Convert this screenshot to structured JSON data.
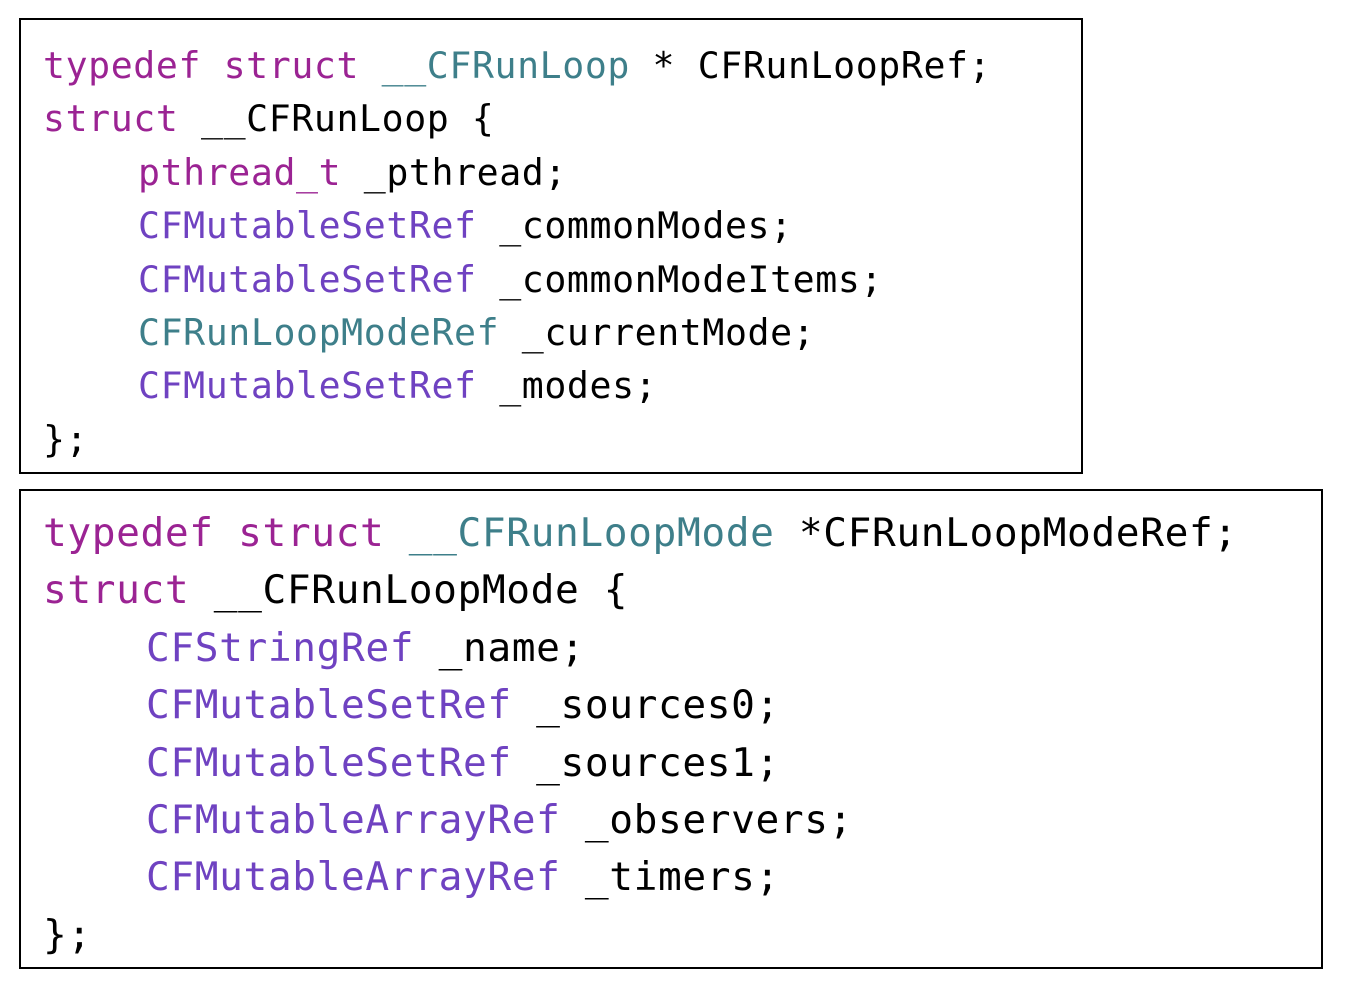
{
  "colors": {
    "keyword": "#9b2393",
    "type": "#6f42c1",
    "class_type": "#3e7f8a",
    "plain": "#000000",
    "border": "#000000",
    "background": "#ffffff"
  },
  "block1": {
    "line1": {
      "kw1": "typedef",
      "kw2": "struct",
      "name": "__CFRunLoop",
      "rest": "* CFRunLoopRef;"
    },
    "line2": {
      "kw": "struct",
      "rest": "__CFRunLoop {"
    },
    "fields": [
      {
        "type": "pthread_t",
        "name": "_pthread;"
      },
      {
        "type": "CFMutableSetRef",
        "name": "_commonModes;"
      },
      {
        "type": "CFMutableSetRef",
        "name": "_commonModeItems;"
      },
      {
        "type": "CFRunLoopModeRef",
        "name": "_currentMode;"
      },
      {
        "type": "CFMutableSetRef",
        "name": "_modes;"
      }
    ],
    "close": "};"
  },
  "block2": {
    "line1": {
      "kw1": "typedef",
      "kw2": "struct",
      "name": "__CFRunLoopMode",
      "rest": "*CFRunLoopModeRef;"
    },
    "line2": {
      "kw": "struct",
      "rest": "__CFRunLoopMode {"
    },
    "fields": [
      {
        "type": "CFStringRef",
        "name": "_name;"
      },
      {
        "type": "CFMutableSetRef",
        "name": "_sources0;"
      },
      {
        "type": "CFMutableSetRef",
        "name": "_sources1;"
      },
      {
        "type": "CFMutableArrayRef",
        "name": "_observers;"
      },
      {
        "type": "CFMutableArrayRef",
        "name": "_timers;"
      }
    ],
    "close": "};"
  }
}
